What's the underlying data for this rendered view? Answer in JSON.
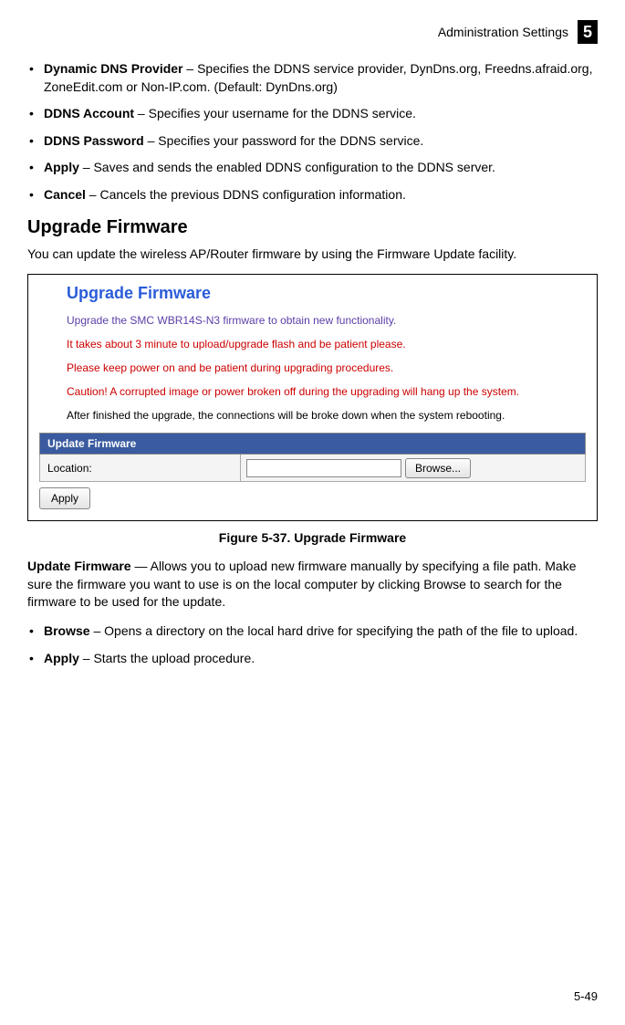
{
  "header": {
    "title": "Administration Settings",
    "chapter": "5"
  },
  "bullets1": [
    {
      "term": "Dynamic DNS Provider",
      "desc": " – Specifies the DDNS service provider, DynDns.org, Freedns.afraid.org, ZoneEdit.com or Non-IP.com. (Default: DynDns.org)"
    },
    {
      "term": "DDNS Account",
      "desc": " – Specifies your username for the DDNS service."
    },
    {
      "term": "DDNS Password",
      "desc": " – Specifies your password for the DDNS service."
    },
    {
      "term": "Apply",
      "desc": " – Saves and sends the enabled DDNS configuration to the DDNS server."
    },
    {
      "term": "Cancel",
      "desc": " – Cancels the previous DDNS configuration information."
    }
  ],
  "section_heading": "Upgrade Firmware",
  "section_intro": "You can update the wireless AP/Router firmware by using the Firmware Update facility.",
  "figure": {
    "title": "Upgrade Firmware",
    "lines": [
      {
        "cls": "fig-purple",
        "text": "Upgrade the SMC WBR14S-N3 firmware to obtain new functionality."
      },
      {
        "cls": "fig-red",
        "text": "It takes about 3 minute to upload/upgrade flash and be patient please."
      },
      {
        "cls": "fig-red",
        "text": "Please keep power on and be patient during upgrading procedures."
      },
      {
        "cls": "fig-red",
        "text": "Caution! A corrupted image or power broken off during the upgrading will hang up the system."
      },
      {
        "cls": "fig-black",
        "text": "After finished the upgrade, the connections will be broke down when the system rebooting."
      }
    ],
    "section_bar": "Update Firmware",
    "location_label": "Location:",
    "location_value": "",
    "browse_label": "Browse...",
    "apply_label": "Apply"
  },
  "figure_caption": "Figure 5-37.   Upgrade Firmware",
  "after_para_term": "Update Firmware",
  "after_para_desc": " — Allows you to upload new firmware manually by specifying a file path. Make sure the firmware you want to use is on the local computer by clicking Browse to search for the firmware to be used for the update.",
  "bullets2": [
    {
      "term": "Browse",
      "desc": " – Opens a directory on the local hard drive for specifying the path of the file to upload."
    },
    {
      "term": "Apply",
      "desc": " – Starts the upload procedure."
    }
  ],
  "page_number": "5-49"
}
